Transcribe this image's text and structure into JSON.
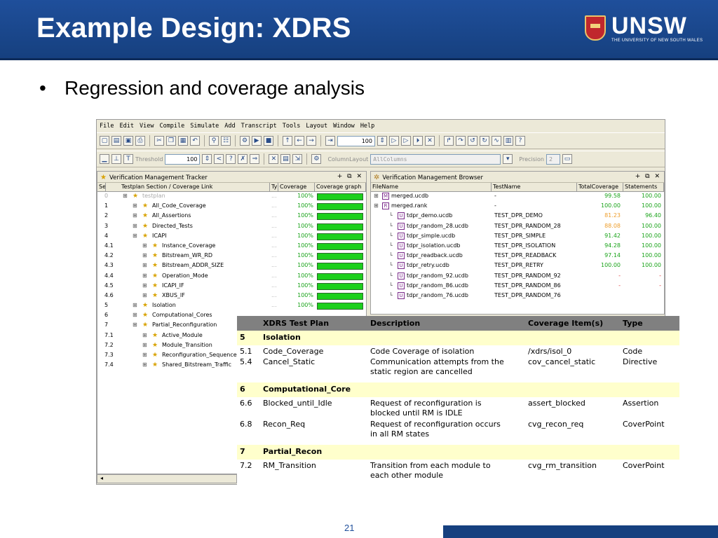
{
  "slide": {
    "title": "Example Design: XDRS",
    "bullet": "Regression and coverage analysis",
    "page_number": "21",
    "logo_text": "UNSW",
    "logo_subtitle": "THE UNIVERSITY OF NEW SOUTH WALES"
  },
  "menu": [
    "File",
    "Edit",
    "View",
    "Compile",
    "Simulate",
    "Add",
    "Transcript",
    "Tools",
    "Layout",
    "Window",
    "Help"
  ],
  "toolbar": {
    "zoom_value": "100",
    "threshold_label": "Threshold",
    "threshold_value": "100",
    "column_layout_label": "ColumnLayout",
    "column_layout_value": "AllColumns",
    "precision_label": "Precision",
    "precision_value": "2"
  },
  "tracker": {
    "title": "Verification Management Tracker",
    "columns": [
      "Sec#",
      "Testplan Section / Coverage Link",
      "Ty",
      "Coverage",
      "Coverage graph"
    ],
    "rows": [
      {
        "sec": "0",
        "name": "testplan",
        "type": "...",
        "coverage": "100%",
        "level": 0,
        "dim": true
      },
      {
        "sec": "1",
        "name": "All_Code_Coverage",
        "type": "...",
        "coverage": "100%",
        "level": 1
      },
      {
        "sec": "2",
        "name": "All_Assertions",
        "type": "...",
        "coverage": "100%",
        "level": 1
      },
      {
        "sec": "3",
        "name": "Directed_Tests",
        "type": "...",
        "coverage": "100%",
        "level": 1
      },
      {
        "sec": "4",
        "name": "ICAPI",
        "type": "...",
        "coverage": "100%",
        "level": 1
      },
      {
        "sec": "4.1",
        "name": "Instance_Coverage",
        "type": "...",
        "coverage": "100%",
        "level": 2
      },
      {
        "sec": "4.2",
        "name": "Bitstream_WR_RD",
        "type": "...",
        "coverage": "100%",
        "level": 2
      },
      {
        "sec": "4.3",
        "name": "Bitstream_ADDR_SIZE",
        "type": "...",
        "coverage": "100%",
        "level": 2
      },
      {
        "sec": "4.4",
        "name": "Operation_Mode",
        "type": "...",
        "coverage": "100%",
        "level": 2
      },
      {
        "sec": "4.5",
        "name": "ICAPI_IF",
        "type": "...",
        "coverage": "100%",
        "level": 2
      },
      {
        "sec": "4.6",
        "name": "XBUS_IF",
        "type": "...",
        "coverage": "100%",
        "level": 2
      },
      {
        "sec": "5",
        "name": "Isolation",
        "type": "...",
        "coverage": "100%",
        "level": 1
      },
      {
        "sec": "6",
        "name": "Computational_Cores",
        "type": "",
        "coverage": "",
        "level": 1
      },
      {
        "sec": "7",
        "name": "Partial_Reconfiguration",
        "type": "",
        "coverage": "",
        "level": 1
      },
      {
        "sec": "7.1",
        "name": "Active_Module",
        "type": "",
        "coverage": "",
        "level": 2
      },
      {
        "sec": "7.2",
        "name": "Module_Transition",
        "type": "",
        "coverage": "",
        "level": 2
      },
      {
        "sec": "7.3",
        "name": "Reconfiguration_Sequence",
        "type": "",
        "coverage": "",
        "level": 2
      },
      {
        "sec": "7.4",
        "name": "Shared_Bitstream_Traffic",
        "type": "",
        "coverage": "",
        "level": 2
      }
    ]
  },
  "browser": {
    "title": "Verification Management Browser",
    "columns": [
      "FileName",
      "TestName",
      "TotalCoverage",
      "Statements"
    ],
    "rows": [
      {
        "file": "merged.ucdb",
        "icon": "M",
        "test": "-",
        "total": "99.58",
        "total_color": "#1aa41a",
        "stmt": "100.00",
        "level": 0
      },
      {
        "file": "merged.rank",
        "icon": "R",
        "test": "-",
        "total": "100.00",
        "total_color": "#1aa41a",
        "stmt": "100.00",
        "level": 0
      },
      {
        "file": "tdpr_demo.ucdb",
        "icon": "U",
        "test": "TEST_DPR_DEMO",
        "total": "81.23",
        "total_color": "#ee9e2c",
        "stmt": "96.40",
        "level": 1
      },
      {
        "file": "tdpr_random_28.ucdb",
        "icon": "U",
        "test": "TEST_DPR_RANDOM_28",
        "total": "88.08",
        "total_color": "#ee9e2c",
        "stmt": "100.00",
        "level": 1
      },
      {
        "file": "tdpr_simple.ucdb",
        "icon": "U",
        "test": "TEST_DPR_SIMPLE",
        "total": "91.42",
        "total_color": "#1aa41a",
        "stmt": "100.00",
        "level": 1
      },
      {
        "file": "tdpr_isolation.ucdb",
        "icon": "U",
        "test": "TEST_DPR_ISOLATION",
        "total": "94.28",
        "total_color": "#1aa41a",
        "stmt": "100.00",
        "level": 1
      },
      {
        "file": "tdpr_readback.ucdb",
        "icon": "U",
        "test": "TEST_DPR_READBACK",
        "total": "97.14",
        "total_color": "#1aa41a",
        "stmt": "100.00",
        "level": 1
      },
      {
        "file": "tdpr_retry.ucdb",
        "icon": "U",
        "test": "TEST_DPR_RETRY",
        "total": "100.00",
        "total_color": "#1aa41a",
        "stmt": "100.00",
        "level": 1
      },
      {
        "file": "tdpr_random_92.ucdb",
        "icon": "U",
        "test": "TEST_DPR_RANDOM_92",
        "total": "-",
        "total_color": "#e03030",
        "stmt": "-",
        "level": 1
      },
      {
        "file": "tdpr_random_86.ucdb",
        "icon": "U",
        "test": "TEST_DPR_RANDOM_86",
        "total": "-",
        "total_color": "#e03030",
        "stmt": "-",
        "level": 1
      },
      {
        "file": "tdpr_random_76.ucdb",
        "icon": "U",
        "test": "TEST_DPR_RANDOM_76",
        "total": "",
        "total_color": "#e03030",
        "stmt": "",
        "level": 1
      }
    ]
  },
  "plan": {
    "headers": [
      "",
      "XDRS Test Plan",
      "Description",
      "Coverage Item(s)",
      "Type"
    ],
    "sections": [
      {
        "num": "5",
        "name": "Isolation",
        "items": [
          {
            "num": "5.1",
            "name": "Code_Coverage",
            "desc": [
              "Code Coverage of isolation"
            ],
            "item": "/xdrs/isol_0",
            "type": "Code"
          },
          {
            "num": "5.4",
            "name": "Cancel_Static",
            "desc": [
              "Communication attempts from the",
              "static region are cancelled"
            ],
            "item": "cov_cancel_static",
            "type": "Directive"
          }
        ]
      },
      {
        "num": "6",
        "name": "Computational_Core",
        "items": [
          {
            "num": "6.6",
            "name": "Blocked_until_Idle",
            "desc": [
              "Request of reconfiguration is",
              "blocked until RM is IDLE"
            ],
            "item": "assert_blocked",
            "type": "Assertion"
          },
          {
            "num": "6.8",
            "name": "Recon_Req",
            "desc": [
              "Request of reconfiguration occurs",
              "in all RM states"
            ],
            "item": "cvg_recon_req",
            "type": "CoverPoint"
          }
        ]
      },
      {
        "num": "7",
        "name": "Partial_Recon",
        "items": [
          {
            "num": "7.2",
            "name": "RM_Transition",
            "desc": [
              "Transition from each module to",
              "each other module"
            ],
            "item": "cvg_rm_transition",
            "type": "CoverPoint"
          }
        ]
      }
    ]
  }
}
